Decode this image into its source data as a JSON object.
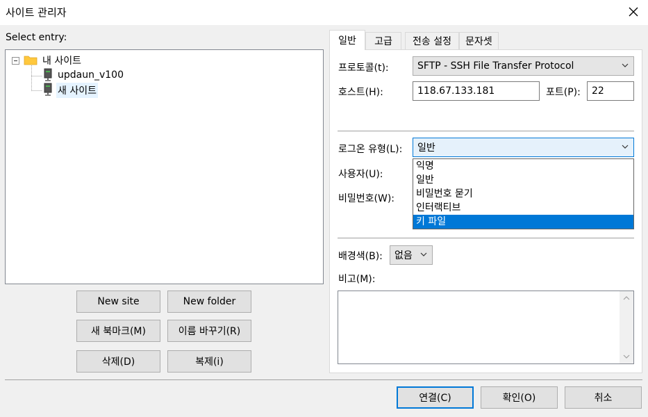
{
  "window": {
    "title": "사이트 관리자"
  },
  "left": {
    "select_entry_label": "Select entry:",
    "tree": {
      "root_label": "내 사이트",
      "children": [
        {
          "label": "updaun_v100"
        },
        {
          "label": "새 사이트"
        }
      ]
    },
    "buttons": {
      "new_site": "New site",
      "new_folder": "New folder",
      "new_bookmark": "새 북마크(M)",
      "rename": "이름 바꾸기(R)",
      "delete": "삭제(D)",
      "duplicate": "복제(i)"
    }
  },
  "tabs": [
    "일반",
    "고급",
    "전송 설정",
    "문자셋"
  ],
  "general": {
    "protocol_label": "프로토콜(t):",
    "protocol_value": "SFTP - SSH File Transfer Protocol",
    "host_label": "호스트(H):",
    "host_value": "118.67.133.181",
    "port_label": "포트(P):",
    "port_value": "22",
    "logon_type_label": "로그온 유형(L):",
    "logon_type_value": "일반",
    "logon_options": [
      "익명",
      "일반",
      "비밀번호 묻기",
      "인터랙티브",
      "키 파일"
    ],
    "logon_highlighted_index": 4,
    "user_label": "사용자(U):",
    "password_label": "비밀번호(W):",
    "background_label": "배경색(B):",
    "background_value": "없음",
    "notes_label": "비고(M):"
  },
  "footer": {
    "connect": "연결(C)",
    "ok": "확인(O)",
    "cancel": "취소"
  },
  "colors": {
    "accent": "#0078d7",
    "selection_bg": "#cce8ff",
    "folder": "#ffc83d"
  }
}
